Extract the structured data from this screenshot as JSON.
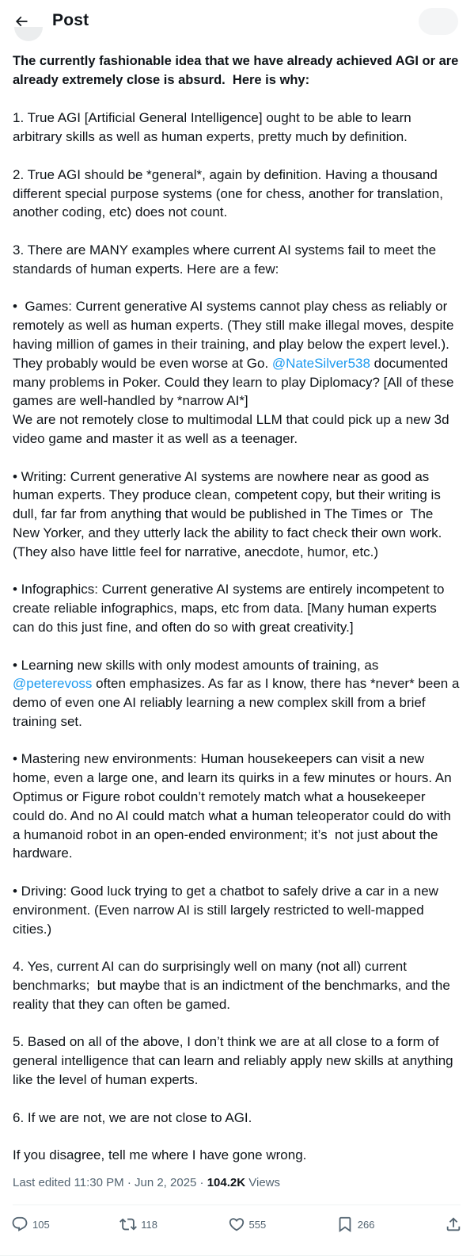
{
  "header": {
    "title": "Post",
    "back_icon": "arrow-left-icon"
  },
  "tweet": {
    "intro": "The currently fashionable idea that we have already achieved AGI or are already extremely close is absurd.  Here is why:",
    "p1": "1. True AGI [Artificial General Intelligence] ought to be able to learn arbitrary skills as well as human experts, pretty much by definition.",
    "p2": "2. True AGI should be *general*, again by definition. Having a thousand different special purpose systems (one for chess, another for translation, another coding, etc) does not count.",
    "p3": "3. There are MANY examples where current AI systems fail to meet the standards of human experts. Here are a few:",
    "games": {
      "before": "•  Games: Current generative AI systems cannot play chess as reliably or remotely as well as human experts. (They still make illegal moves, despite having million of games in their training, and play below the expert level.). They probably would be even worse at Go. ",
      "mention": "@NateSilver538",
      "after": " documented many problems in Poker. Could they learn to play Diplomacy? [All of these games are well-handled by *narrow AI*]\nWe are not remotely close to multimodal LLM that could pick up a new 3d video game and master it as well as a teenager."
    },
    "writing": "• Writing: Current generative AI systems are nowhere near as good as human experts. They produce clean, competent copy, but their writing is dull, far far from anything that would be published in The Times or  The New Yorker, and they utterly lack the ability to fact check their own work. (They also have little feel for narrative, anecdote, humor, etc.)",
    "infographics": "• Infographics: Current generative AI systems are entirely incompetent to create reliable infographics, maps, etc from data. [Many human experts can do this just fine, and often do so with great creativity.]",
    "learning": {
      "before": "• Learning new skills with only modest amounts of training, as\n",
      "mention": "@peterevoss",
      "after": " often emphasizes. As far as I know, there has *never* been a demo of even one AI reliably learning a new complex skill from a brief training set."
    },
    "mastering": "• Mastering new environments: Human housekeepers can visit a new home, even a large one, and learn its quirks in a few minutes or hours. An Optimus or Figure robot couldn’t remotely match what a housekeeper could do. And no AI could match what a human teleoperator could do with a humanoid robot in an open-ended environment; it’s  not just about the hardware.",
    "driving": "• Driving: Good luck trying to get a chatbot to safely drive a car in a new environment. (Even narrow AI is still largely restricted to well-mapped cities.)",
    "p4": "4. Yes, current AI can do surprisingly well on many (not all) current benchmarks;  but maybe that is an indictment of the benchmarks, and the reality that they can often be gamed.",
    "p5": "5. Based on all of the above, I don’t think we are at all close to a form of general intelligence that can learn and reliably apply new skills at anything like the level of human experts.",
    "p6": "6. If we are not, we are not close to AGI.",
    "closing": "If you disagree, tell me where I have gone wrong."
  },
  "meta": {
    "edited": "Last edited 11:30 PM · Jun 2, 2025 · ",
    "views_count": "104.2K",
    "views_label": " Views"
  },
  "actions": {
    "replies": "105",
    "reposts": "118",
    "likes": "555",
    "bookmarks": "266"
  },
  "colors": {
    "accent": "#1d9bf0",
    "text": "#0f1419",
    "muted": "#536471"
  }
}
